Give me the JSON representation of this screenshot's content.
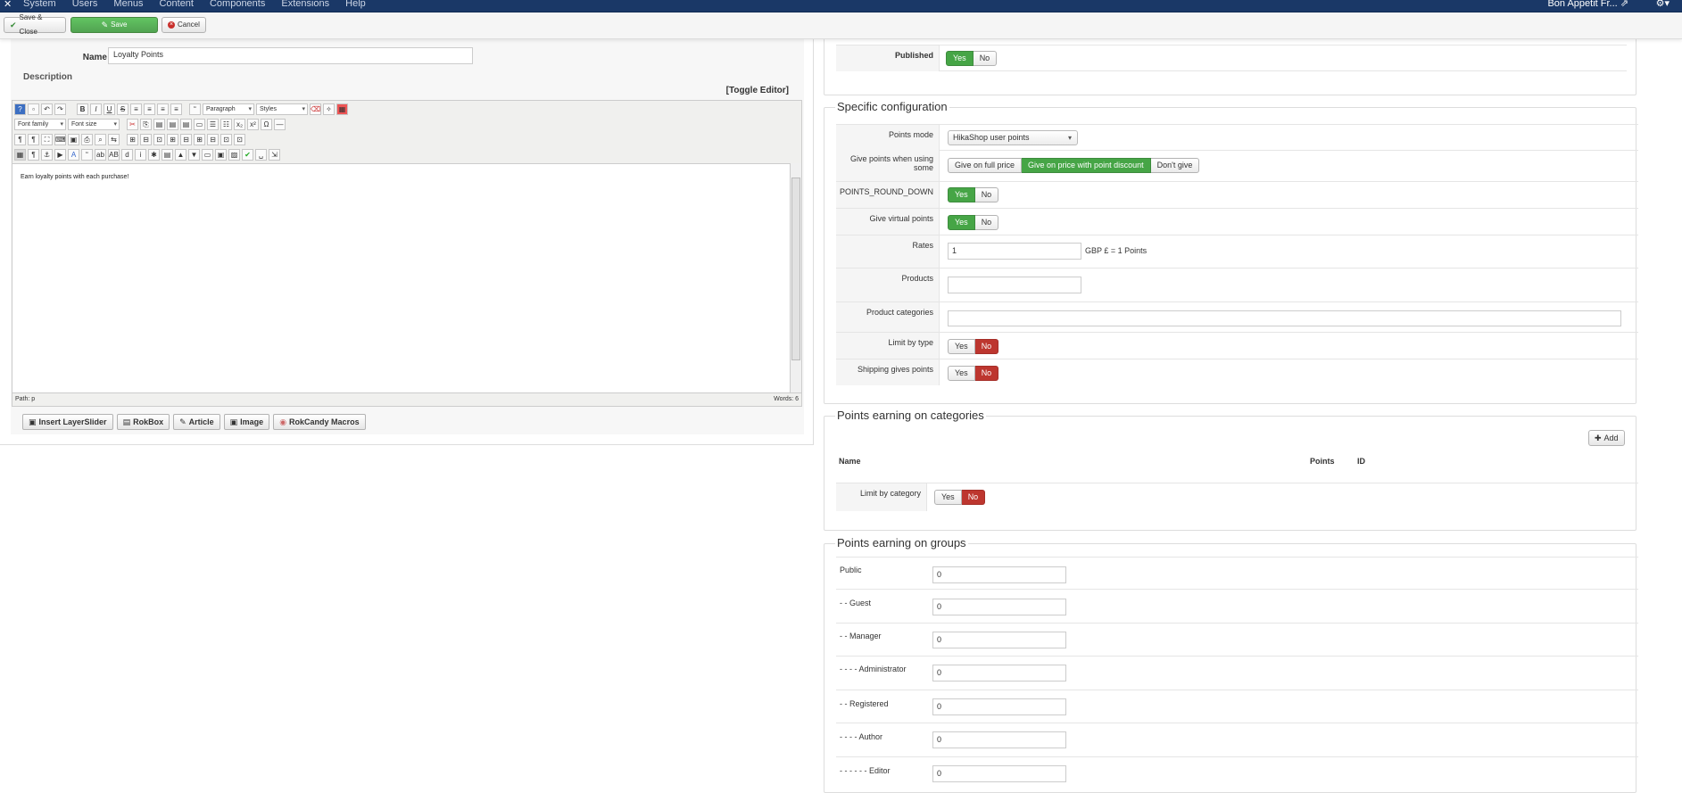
{
  "topbar": {
    "logo": "✕",
    "menu": [
      "System",
      "Users",
      "Menus",
      "Content",
      "Components",
      "Extensions",
      "Help"
    ],
    "site_name": "Bon Appetit Fr... ⇗",
    "settings_icon": "gear-icon"
  },
  "toolbar": {
    "save_close_label": "Save & Close",
    "save_label": "Save",
    "cancel_label": "Cancel"
  },
  "left": {
    "name_label": "Name",
    "name_value": "Loyalty Points",
    "description_label": "Description",
    "toggle_editor_label": "[Toggle Editor]",
    "editor": {
      "format_select": "Paragraph",
      "styles_select": "Styles",
      "font_family_select": "Font family",
      "font_size_select": "Font size",
      "content": "Earn loyalty points with each purchase!",
      "path_text": "Path:  p",
      "words_text": "Words: 6"
    },
    "editor_buttons": {
      "layerslider": "Insert LayerSlider",
      "rokbox": "RokBox",
      "article": "Article",
      "image": "Image",
      "rokcandy": "RokCandy Macros"
    }
  },
  "published": {
    "label": "Published",
    "yes": "Yes",
    "no": "No"
  },
  "specific": {
    "title": "Specific configuration",
    "points_mode_label": "Points mode",
    "points_mode_value": "HikaShop user points",
    "give_points_label": "Give points when using some",
    "give_points_options": [
      "Give on full price",
      "Give on price with point discount",
      "Don't give"
    ],
    "round_down_label": "POINTS_ROUND_DOWN",
    "virtual_label": "Give virtual points",
    "rates_label": "Rates",
    "rates_value": "1",
    "rates_suffix": "GBP £ = 1 Points",
    "products_label": "Products",
    "product_categories_label": "Product categories",
    "limit_type_label": "Limit by type",
    "shipping_label": "Shipping gives points",
    "yes": "Yes",
    "no": "No"
  },
  "categories": {
    "title": "Points earning on categories",
    "add_label": "Add",
    "col_name": "Name",
    "col_points": "Points",
    "col_id": "ID",
    "limit_label": "Limit by category",
    "yes": "Yes",
    "no": "No"
  },
  "groups": {
    "title": "Points earning on groups",
    "rows": [
      {
        "label": "Public",
        "value": "0"
      },
      {
        "label": "- - Guest",
        "value": "0"
      },
      {
        "label": "- - Manager",
        "value": "0"
      },
      {
        "label": "- - - - Administrator",
        "value": "0"
      },
      {
        "label": "- - Registered",
        "value": "0"
      },
      {
        "label": "- - - - Author",
        "value": "0"
      },
      {
        "label": "- - - - - - Editor",
        "value": "0"
      }
    ]
  }
}
